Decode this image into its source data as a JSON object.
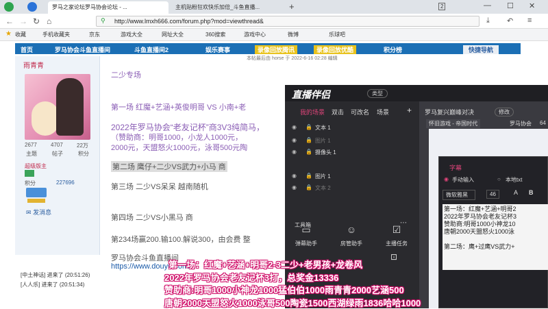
{
  "browser": {
    "tabs": [
      {
        "label": "罗马之家论坛罗马协会论坛 - ..."
      },
      {
        "label": "主机贴粉狂欢快乐加倍_斗鱼直播..."
      }
    ],
    "url": "http://www.lmxh666.com/forum.php?mod=viewthread&",
    "bookmarks": [
      "收藏",
      "手机收藏夹",
      "京东",
      "游戏大全",
      "网址大全",
      "360搜索",
      "游戏中心",
      "微博",
      "乐球吧"
    ],
    "window_tab_count": "2"
  },
  "site": {
    "nav": [
      "首页",
      "罗马协会斗鱼直播间",
      "斗鱼直播间2",
      "娱乐赛事",
      "录像回放腾讯",
      "录像回放优酷",
      "积分榜",
      "快捷导航"
    ],
    "post_info": "本帖最后由 horse 于 2022-6-16 02:28 编辑",
    "author": "雨青青",
    "stats": [
      {
        "value": "2677",
        "label": "主题"
      },
      {
        "value": "4707",
        "label": "帖子"
      },
      {
        "value": "22万",
        "label": "积分"
      }
    ],
    "rank": "超级版主",
    "points_label": "积分",
    "points_value": "227696",
    "send_msg": "发消息",
    "post_lines": [
      "二少专场",
      "第一场  红魔+艺涵+英俊明哥  VS  小南+老",
      "2022年罗马协会“老友记杯”商3V3纯简马，",
      "（赞助商：明哥1000，小龙人1000元，",
      "2000元，天盟怒火1000元，泳哥500元陶",
      "第二场    鹰仔+二少VS武力+小马  商",
      "第三场  二少VS呆呆  越南随机",
      "第四场  二少VS小黑马  商",
      "第234场赢200.输100.解说300，由会费 整",
      "罗马协会斗鱼直播间",
      "https://www.douyu.com/6"
    ]
  },
  "app": {
    "title": "直播伴侣",
    "type_btn": "类型",
    "scene_tabs": [
      "我的场景",
      "双击",
      "可改名",
      "场景"
    ],
    "add_btn": "+",
    "room_title": "罗马复兴巅峰对决",
    "edit_btn": "修改",
    "category": "怀旧游戏 - 帝国时代",
    "channel": "罗马协会",
    "channel_num": "64",
    "layers": [
      "文本 1",
      "图片 1",
      "摄像头 1",
      "图片 1",
      "文本 2"
    ],
    "toolbox_label": "工具箱",
    "tools": [
      "弹幕助手",
      "房管助手",
      "主播任务"
    ],
    "subtitle_dialog": {
      "title": "字幕",
      "mode_manual": "手动输入",
      "mode_local": "本地txt",
      "font": "微软雅黑",
      "size": "46",
      "text": "第一场：红魔+艺涵+明哥2\n2022年罗马协会老友记杯3\n赞助商:明哥1000小神龙10\n唐朝2000天盟怒火1000泳\n\n第二场：鹰+过鹰VS武力+"
    }
  },
  "captions": [
    "第一场：红魔+艺涵+明哥2-3二少+老男孩+龙卷风",
    "2022年罗马协会老友记杯3打，总奖金13336",
    "赞助商:明哥1000小神龙1000猛伯伯1000雨青青2000艺涵500",
    "唐朝2000天盟怒火1000泳哥500陶瓷1500西湖绿雨1836哈哈1000"
  ],
  "chat": [
    "[中土神话] 进来了 (20:51:26)",
    "[人人乐] 进来了 (20:51:34)"
  ]
}
